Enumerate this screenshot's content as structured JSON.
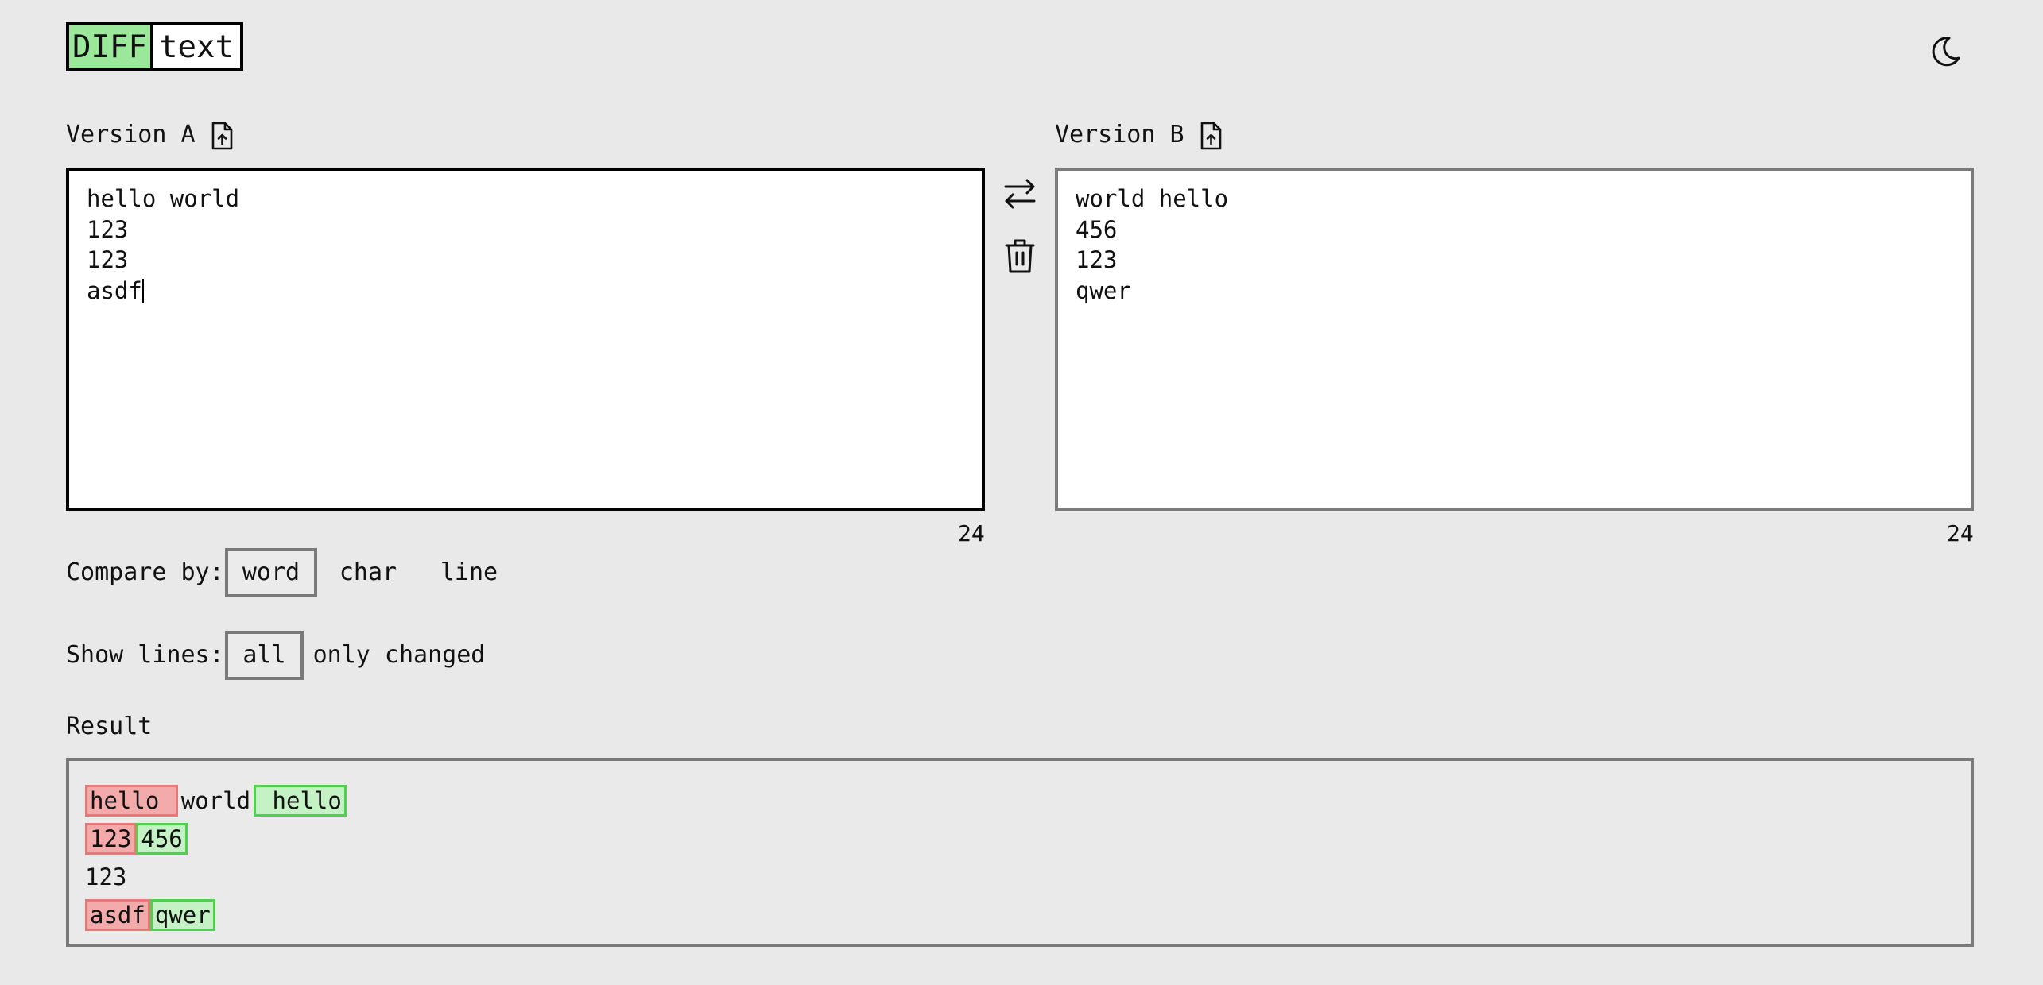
{
  "logo": {
    "part1": "DIFF",
    "part2": "text"
  },
  "theme_toggle_icon": "moon-icon",
  "version_a": {
    "label": "Version A",
    "upload_icon": "file-upload-icon",
    "lines": [
      "hello world",
      "123",
      "123",
      "asdf"
    ],
    "char_count": "24"
  },
  "version_b": {
    "label": "Version B",
    "upload_icon": "file-upload-icon",
    "lines": [
      "world hello",
      "456",
      "123",
      "qwer"
    ],
    "char_count": "24"
  },
  "actions": {
    "swap_icon": "swap-arrows-icon",
    "clear_icon": "trash-icon"
  },
  "compare_by": {
    "label": "Compare by:",
    "options": [
      "word",
      "char",
      "line"
    ],
    "selected": "word"
  },
  "show_lines": {
    "label": "Show lines:",
    "options": [
      "all",
      "only changed"
    ],
    "selected": "all"
  },
  "result": {
    "label": "Result",
    "lines": [
      [
        {
          "type": "del",
          "text": "hello "
        },
        {
          "type": "eq",
          "text": "world"
        },
        {
          "type": "add",
          "text": " hello"
        }
      ],
      [
        {
          "type": "del",
          "text": "123"
        },
        {
          "type": "add",
          "text": "456"
        }
      ],
      [
        {
          "type": "eq",
          "text": "123"
        }
      ],
      [
        {
          "type": "del",
          "text": "asdf"
        },
        {
          "type": "add",
          "text": "qwer"
        }
      ]
    ]
  },
  "colors": {
    "logo_accent": "#9be89b",
    "removed_bg": "#f3aaaa",
    "removed_border": "#e87878",
    "added_bg": "#c5f2c5",
    "added_border": "#4fd04f"
  }
}
